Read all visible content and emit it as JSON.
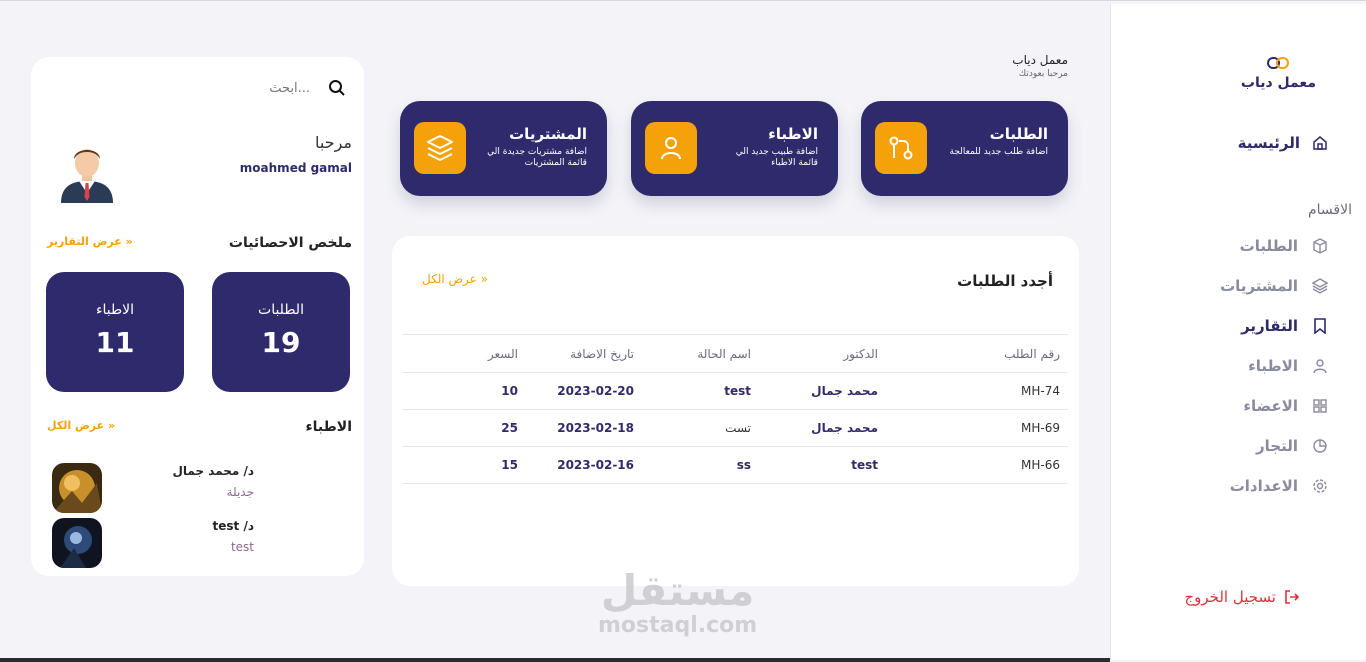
{
  "brand": {
    "name": "معمل دياب"
  },
  "sidebar": {
    "home": "الرئيسية",
    "section": "الاقسام",
    "items": [
      {
        "label": "الطلبات",
        "icon": "box-icon"
      },
      {
        "label": "المشتريات",
        "icon": "layers-icon"
      },
      {
        "label": "التقارير",
        "icon": "bookmark-icon"
      },
      {
        "label": "الاطباء",
        "icon": "user-icon"
      },
      {
        "label": "الاعضاء",
        "icon": "grid-icon"
      },
      {
        "label": "التجار",
        "icon": "pie-chart-icon"
      },
      {
        "label": "الاعدادات",
        "icon": "gear-icon"
      }
    ],
    "logout": "تسجيل الخروج"
  },
  "header": {
    "title": "معمل دياب",
    "subtitle": "مرحبا بعودتك"
  },
  "cards": [
    {
      "title": "الطلبات",
      "desc": "اضافة طلب جديد للمعالجة",
      "icon": "git-pull-icon"
    },
    {
      "title": "الاطباء",
      "desc": "اضافة طبيب جديد الي قائمة الاطباء",
      "icon": "user-icon"
    },
    {
      "title": "المشتريات",
      "desc": "اضافة مشتريات جديدة الي قائمة المشتريات",
      "icon": "layers-icon"
    }
  ],
  "orders": {
    "title": "أجدد الطلبات",
    "view_all": "عرض الكل »",
    "columns": [
      "رقم الطلب",
      "الدكتور",
      "اسم الحالة",
      "تاريخ الاضافة",
      "السعر"
    ],
    "rows": [
      {
        "code": "MH-74",
        "doctor": "محمد جمال",
        "case": "test",
        "date": "2023-02-20",
        "price": "10"
      },
      {
        "code": "MH-69",
        "doctor": "محمد جمال",
        "case": "تست",
        "date": "2023-02-18",
        "price": "25"
      },
      {
        "code": "MH-66",
        "doctor": "test",
        "case": "ss",
        "date": "2023-02-16",
        "price": "15"
      }
    ]
  },
  "profile": {
    "search_placeholder": "ابحث...",
    "hello": "مرحبا",
    "username": "moahmed gamal",
    "stats_title": "ملخص الاحصائيات",
    "stats_link": "عرض التقارير »",
    "stats": [
      {
        "label": "الطلبات",
        "value": "19"
      },
      {
        "label": "الاطباء",
        "value": "11"
      }
    ],
    "doctors_title": "الاطباء",
    "doctors_link": "عرض الكل »",
    "doctors": [
      {
        "name": "د/ محمد جمال",
        "specialty": "جديلة"
      },
      {
        "name": "د/ test",
        "specialty": "test"
      }
    ]
  },
  "watermark": {
    "arabic": "مستقل",
    "latin": "mostaql.com"
  },
  "colors": {
    "primary": "#2f2a6b",
    "accent": "#f5a10a",
    "danger": "#e0323c"
  }
}
